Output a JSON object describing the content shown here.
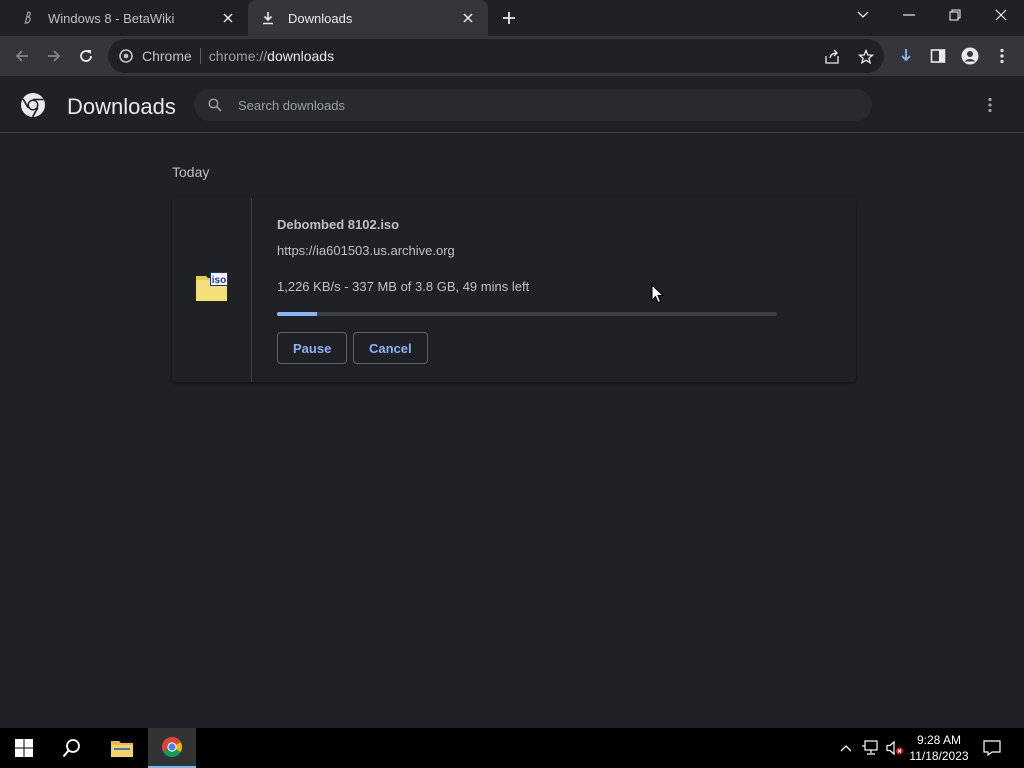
{
  "browser": {
    "tabs": [
      {
        "title": "Windows 8 - BetaWiki",
        "icon": "betawiki-favicon",
        "active": false
      },
      {
        "title": "Downloads",
        "icon": "download-icon",
        "active": true
      }
    ],
    "omnibox": {
      "site_label": "Chrome",
      "url_prefix": "chrome://",
      "url_host": "downloads"
    }
  },
  "downloads_page": {
    "title": "Downloads",
    "search_placeholder": "Search downloads",
    "date_group": "Today",
    "item": {
      "file_name": "Debombed 8102.iso",
      "source_url": "https://ia601503.us.archive.org",
      "status": "1,226 KB/s - 337 MB of 3.8 GB, 49 mins left",
      "progress_fraction": 0.08,
      "file_icon_badge": "iso",
      "pause_label": "Pause",
      "cancel_label": "Cancel"
    }
  },
  "taskbar": {
    "time": "9:28 AM",
    "date": "11/18/2023"
  },
  "colors": {
    "page_bg": "#202124",
    "toolbar_bg": "#35363a",
    "accent": "#8ab4f8"
  }
}
